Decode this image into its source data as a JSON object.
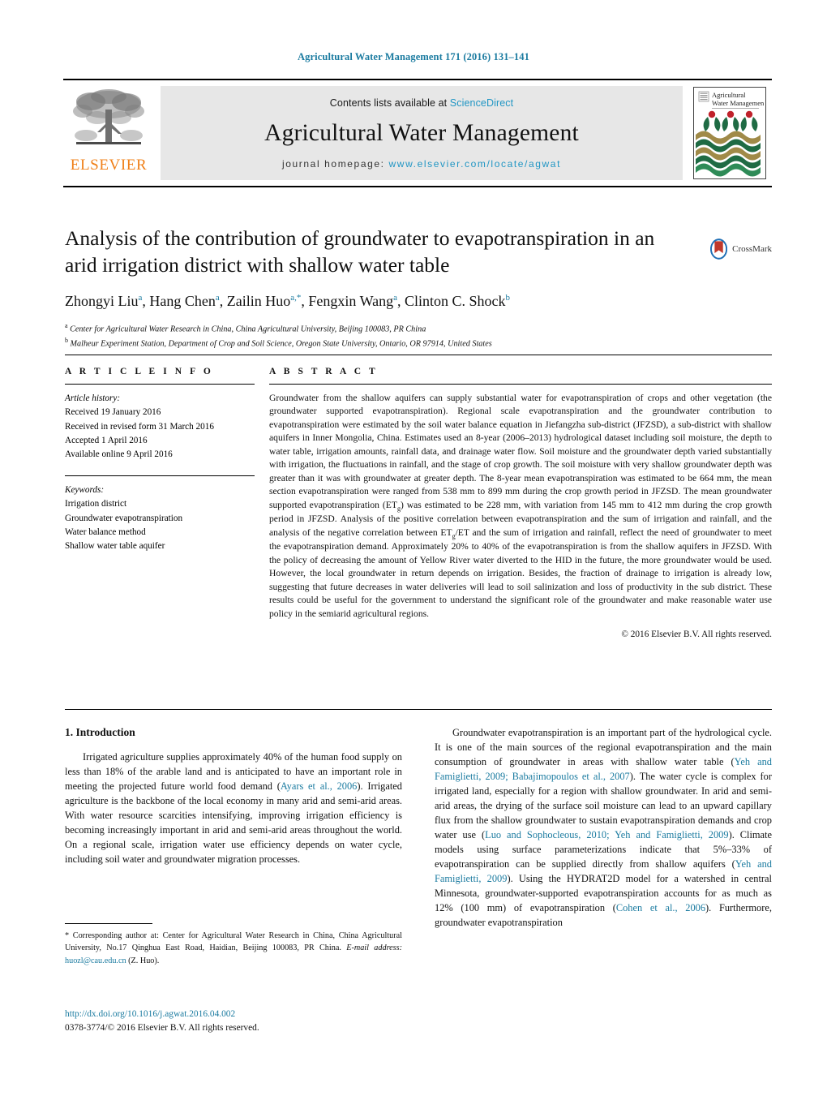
{
  "running_head": "Agricultural Water Management 171 (2016) 131–141",
  "masthead": {
    "publisher_name": "ELSEVIER",
    "contents_prefix": "Contents lists available at ",
    "contents_link": "ScienceDirect",
    "journal_name": "Agricultural Water Management",
    "homepage_prefix": "journal homepage: ",
    "homepage_url": "www.elsevier.com/locate/agwat",
    "cover_title_line1": "Agricultural",
    "cover_title_line2": "Water Management"
  },
  "article": {
    "title": "Analysis of the contribution of groundwater to evapotranspiration in an arid irrigation district with shallow water table",
    "crossmark_label": "CrossMark",
    "authors_html": "Zhongyi Liu<sup>a</sup>, Hang Chen<sup>a</sup>, Zailin Huo<sup>a,*</sup>, Fengxin Wang<sup>a</sup>, Clinton C. Shock<sup>b</sup>",
    "affiliations": [
      {
        "marker": "a",
        "text": "Center for Agricultural Water Research in China, China Agricultural University, Beijing 100083, PR China"
      },
      {
        "marker": "b",
        "text": "Malheur Experiment Station, Department of Crop and Soil Science, Oregon State University, Ontario, OR 97914, United States"
      }
    ]
  },
  "article_info": {
    "heading": "A R T I C L E   I N F O",
    "history_title": "Article history:",
    "history": [
      "Received 19 January 2016",
      "Received in revised form 31 March 2016",
      "Accepted 1 April 2016",
      "Available online 9 April 2016"
    ],
    "keywords_title": "Keywords:",
    "keywords": [
      "Irrigation district",
      "Groundwater evapotranspiration",
      "Water balance method",
      "Shallow water table aquifer"
    ]
  },
  "abstract": {
    "heading": "A B S T R A C T",
    "text_html": "Groundwater from the shallow aquifers can supply substantial water for evapotranspiration of crops and other vegetation (the groundwater supported evapotranspiration). Regional scale evapotranspiration and the groundwater contribution to evapotranspiration were estimated by the soil water balance equation in Jiefangzha sub-district (JFZSD), a sub-district with shallow aquifers in Inner Mongolia, China. Estimates used an 8-year (2006–2013) hydrological dataset including soil moisture, the depth to water table, irrigation amounts, rainfall data, and drainage water flow. Soil moisture and the groundwater depth varied substantially with irrigation, the fluctuations in rainfall, and the stage of crop growth. The soil moisture with very shallow groundwater depth was greater than it was with groundwater at greater depth. The 8-year mean evapotranspiration was estimated to be 664 mm, the mean section evapotranspiration were ranged from 538 mm to 899 mm during the crop growth period in JFZSD. The mean groundwater supported evapotranspiration (ET<sub>g</sub>) was estimated to be 228 mm, with variation from 145 mm to 412 mm during the crop growth period in JFZSD. Analysis of the positive correlation between evapotranspiration and the sum of irrigation and rainfall, and the analysis of the negative correlation between ET<sub>g</sub>/ET and the sum of irrigation and rainfall, reflect the need of groundwater to meet the evapotranspiration demand. Approximately 20% to 40% of the evapotranspiration is from the shallow aquifers in JFZSD. With the policy of decreasing the amount of Yellow River water diverted to the HID in the future, the more groundwater would be used. However, the local groundwater in return depends on irrigation. Besides, the fraction of drainage to irrigation is already low, suggesting that future decreases in water deliveries will lead to soil salinization and loss of productivity in the sub district. These results could be useful for the government to understand the significant role of the groundwater and make reasonable water use policy in the semiarid agricultural regions.",
    "copyright": "© 2016 Elsevier B.V. All rights reserved."
  },
  "introduction": {
    "heading": "1.  Introduction",
    "left_paragraph_html": "Irrigated agriculture supplies approximately 40% of the human food supply on less than 18% of the arable land and is anticipated to have an important role in meeting the projected future world food demand (<span class=\"cit\">Ayars et al., 2006</span>). Irrigated agriculture is the backbone of the local economy in many arid and semi-arid areas. With water resource scarcities intensifying, improving irrigation efficiency is becoming increasingly important in arid and semi-arid areas throughout the world. On a regional scale, irrigation water use efficiency depends on water cycle, including soil water and groundwater migration processes.",
    "right_paragraph_html": "Groundwater evapotranspiration is an important part of the hydrological cycle. It is one of the main sources of the regional evapotranspiration and the main consumption of groundwater in areas with shallow water table (<span class=\"cit\">Yeh and Famiglietti, 2009; Babajimopoulos et al., 2007</span>). The water cycle is complex for irrigated land, especially for a region with shallow groundwater. In arid and semi-arid areas, the drying of the surface soil moisture can lead to an upward capillary flux from the shallow groundwater to sustain evapotranspiration demands and crop water use (<span class=\"cit\">Luo and Sophocleous, 2010; Yeh and Famiglietti, 2009</span>). Climate models using surface parameterizations indicate that 5%–33% of evapotranspiration can be supplied directly from shallow aquifers (<span class=\"cit\">Yeh and Famiglietti, 2009</span>). Using the HYDRAT2D model for a watershed in central Minnesota, groundwater-supported evapotranspiration accounts for as much as 12% (100 mm) of evapotranspiration (<span class=\"cit\">Cohen et al., 2006</span>). Furthermore, groundwater evapotranspiration"
  },
  "footnote": {
    "text_html": "* Corresponding author at: Center for Agricultural Water Research in China, China Agricultural University, No.17 Qinghua East Road, Haidian, Beijing 100083, PR China.",
    "email_label": "E-mail address:",
    "email": "huozl@cau.edu.cn",
    "email_suffix": "(Z. Huo)."
  },
  "footer": {
    "doi": "http://dx.doi.org/10.1016/j.agwat.2016.04.002",
    "issn_line": "0378-3774/© 2016 Elsevier B.V. All rights reserved."
  },
  "colors": {
    "link_blue": "#1b7ba0",
    "sciencedirect_blue": "#2196c4",
    "elsevier_orange": "#f08019",
    "masthead_gray": "#e7e7e7"
  }
}
